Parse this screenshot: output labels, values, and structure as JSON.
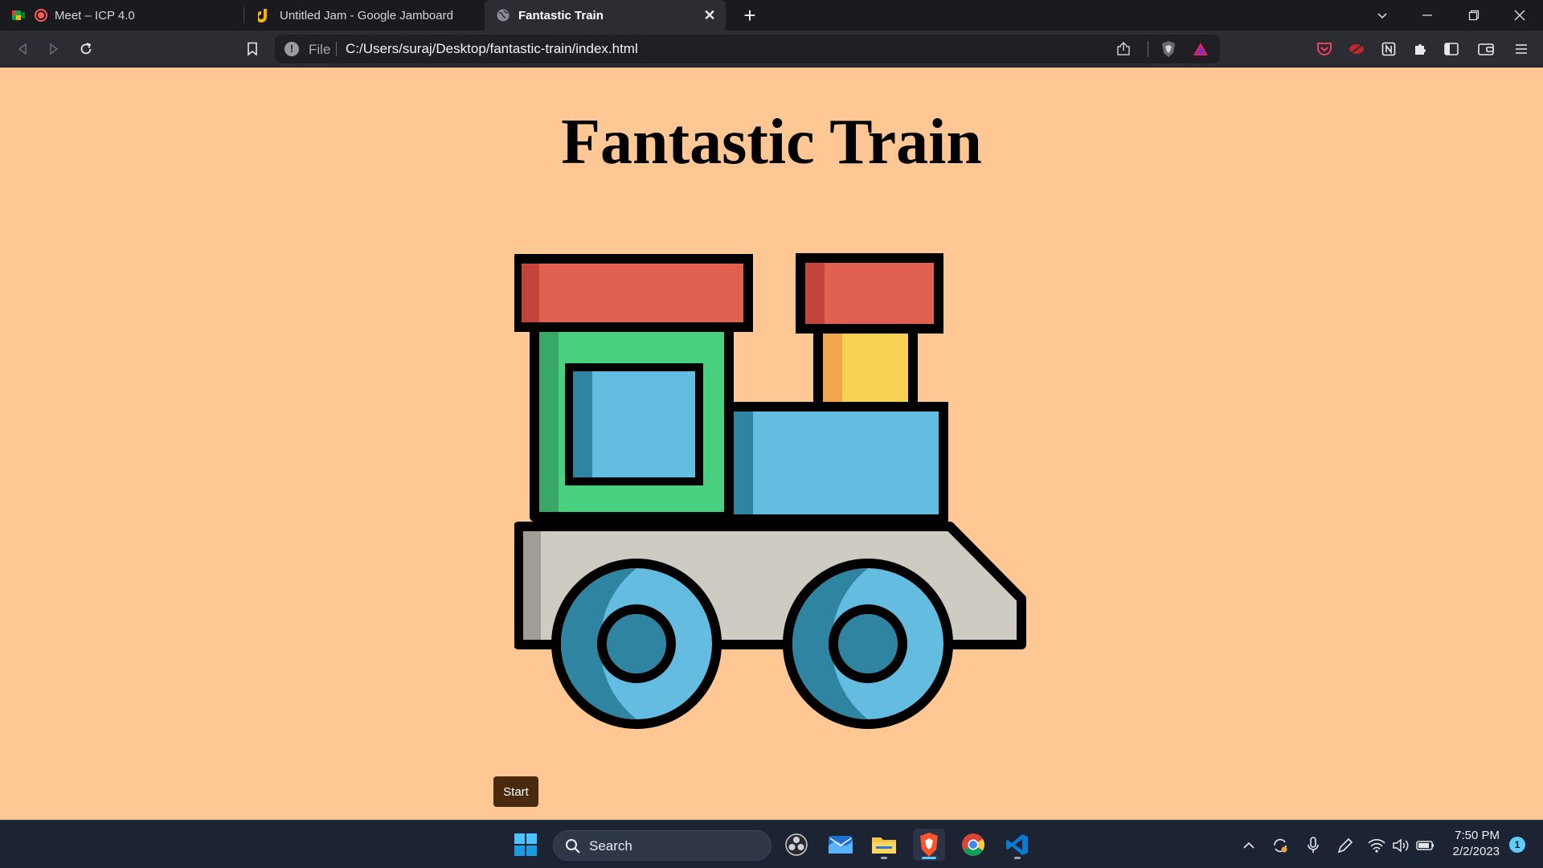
{
  "browser": {
    "tabs": [
      {
        "title": "Meet – ICP 4.0",
        "active": false,
        "icon": "google-meet-icon"
      },
      {
        "title": "Untitled Jam - Google Jamboard",
        "active": false,
        "icon": "jamboard-icon"
      },
      {
        "title": "Fantastic Train",
        "active": true,
        "icon": "globe-icon"
      }
    ],
    "address": {
      "scheme_label": "File",
      "url": "C:/Users/suraj/Desktop/fantastic-train/index.html"
    }
  },
  "page": {
    "title": "Fantastic Train",
    "start_label": "Start",
    "background": "#ffc794"
  },
  "taskbar": {
    "search_label": "Search",
    "time": "7:50 PM",
    "date": "2/2/2023",
    "notification_count": "1",
    "pinned_apps": [
      "windows-start-icon",
      "obs-icon",
      "mail-icon",
      "file-explorer-icon",
      "brave-icon",
      "chrome-icon",
      "vscode-icon"
    ]
  }
}
